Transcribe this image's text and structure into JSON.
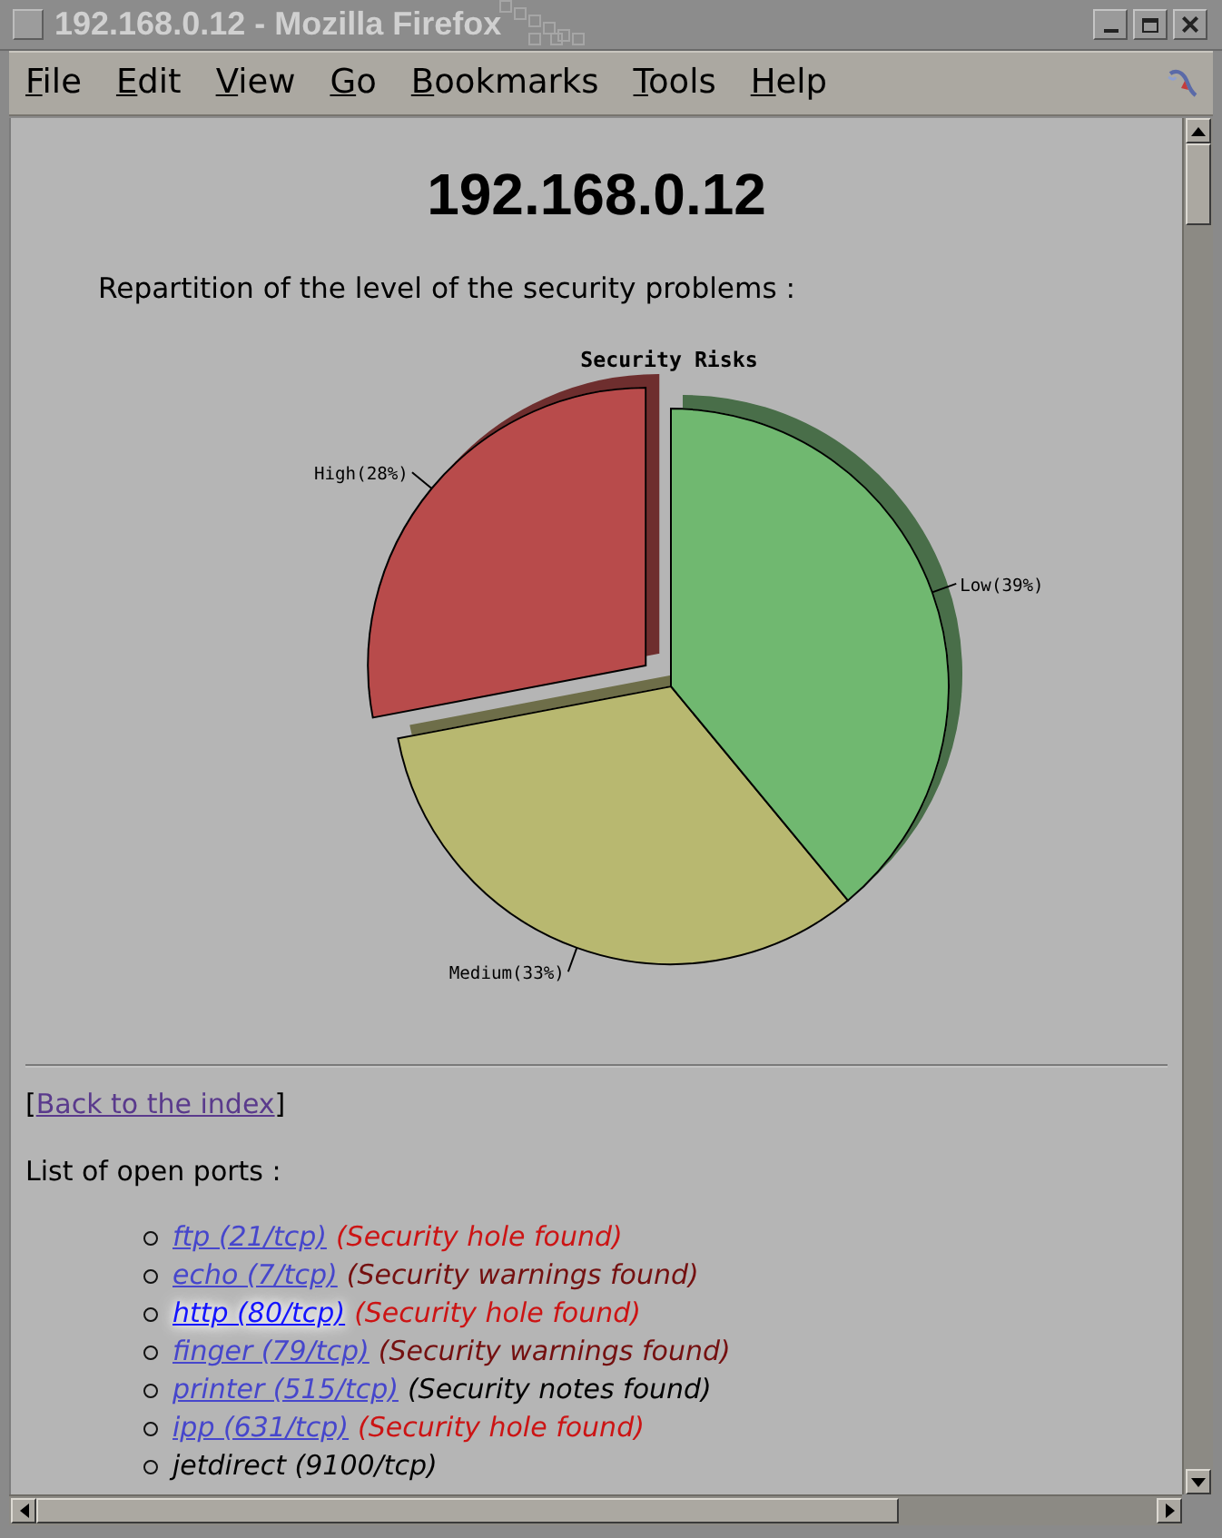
{
  "window": {
    "title": "192.168.0.12 - Mozilla Firefox"
  },
  "menu": [
    {
      "label": "File"
    },
    {
      "label": "Edit"
    },
    {
      "label": "View"
    },
    {
      "label": "Go"
    },
    {
      "label": "Bookmarks"
    },
    {
      "label": "Tools"
    },
    {
      "label": "Help"
    }
  ],
  "page": {
    "heading": "192.168.0.12",
    "intro": "Repartition of the level of the security problems :",
    "chart_data": {
      "type": "pie",
      "title": "Security Risks",
      "categories": [
        "Low",
        "Medium",
        "High"
      ],
      "values": [
        39,
        33,
        28
      ],
      "value_labels": [
        "(39%)",
        "(33%)",
        "(28%)"
      ]
    },
    "back_link": {
      "before": "[",
      "label": "Back to the index",
      "after": "]"
    },
    "ports_heading": "List of open ports :",
    "ports": [
      {
        "kind": "link",
        "service": "ftp (21/tcp)",
        "hovered": false,
        "status": "(Security hole found)",
        "color": "#cc1414"
      },
      {
        "kind": "link",
        "service": "echo (7/tcp)",
        "hovered": false,
        "status": "(Security warnings found)",
        "color": "#741010"
      },
      {
        "kind": "link",
        "service": "http (80/tcp)",
        "hovered": true,
        "status": "(Security hole found)",
        "color": "#cc1414"
      },
      {
        "kind": "link",
        "service": "finger (79/tcp)",
        "hovered": false,
        "status": "(Security warnings found)",
        "color": "#741010"
      },
      {
        "kind": "link",
        "service": "printer (515/tcp)",
        "hovered": false,
        "status": "(Security notes found)",
        "color": "#000000"
      },
      {
        "kind": "link",
        "service": "ipp (631/tcp)",
        "hovered": false,
        "status": "(Security hole found)",
        "color": "#cc1414"
      },
      {
        "kind": "text",
        "service": "jetdirect (9100/tcp)",
        "hovered": false
      }
    ]
  }
}
